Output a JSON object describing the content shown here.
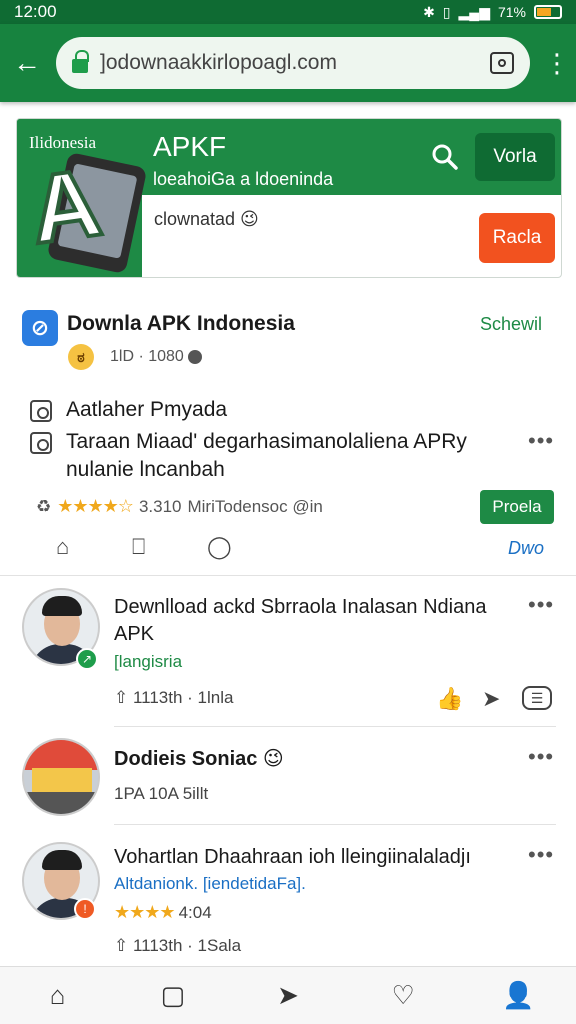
{
  "status_bar": {
    "time": "12:00",
    "battery": "71%"
  },
  "browser": {
    "url": "]odownaakkirlopoagl.com"
  },
  "banner": {
    "country": "Ilidonesia",
    "title": "APKF",
    "subtitle": "loeahoiGa a ldoeninda",
    "button_primary": "Vorla",
    "description": "clownatad 😉",
    "button_secondary": "Racla"
  },
  "post": {
    "title": "Downla APK Indonesia",
    "link": "Schewil",
    "meta": "1lD · 1080",
    "line1": "Aatlaher Pmyada",
    "line2": "Taraan Miaad' degarhasimanolaliena APRy nulanie lncanbah",
    "rating": "3.310",
    "author": "MiriTodensoc @in",
    "action_button": "Proela",
    "footer_link": "Dwo"
  },
  "feed": [
    {
      "title": "Dewnlload ackd Sbrraola Inalasan Ndiana APK",
      "subtitle": "[langisria",
      "meta": "1113th · 1lnla"
    },
    {
      "title": "Dodieis Soniac 😉",
      "meta": "1PA  10A  5illt"
    },
    {
      "title": "Vohartlan Dhaahraan ioh lleingiinalaladjı",
      "subtitle": "Altdanionk. [iendetidaFa].",
      "rating": "4:04",
      "meta": "1113th · 1Sala"
    }
  ]
}
